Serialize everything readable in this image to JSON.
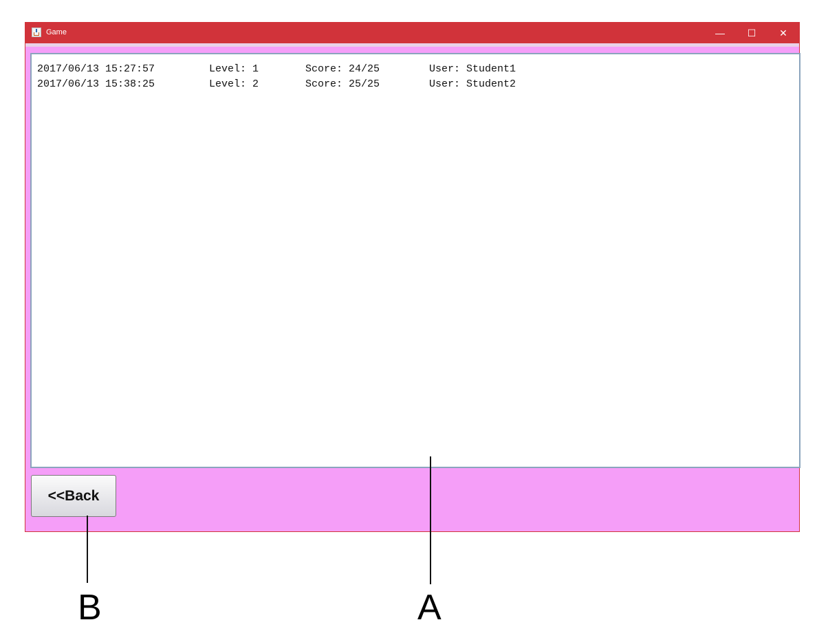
{
  "window": {
    "title": "Game",
    "controls": {
      "minimize": "—",
      "maximize": "☐",
      "close": "✕"
    },
    "accent_color": "#d1333a",
    "background_color": "#f59ef8"
  },
  "log": {
    "rows": [
      {
        "date": "2017/06/13 15:27:57",
        "level": "Level: 1",
        "score": "Score: 24/25",
        "user": "User: Student1"
      },
      {
        "date": "2017/06/13 15:38:25",
        "level": "Level: 2",
        "score": "Score: 25/25",
        "user": "User: Student2"
      }
    ]
  },
  "buttons": {
    "back_label": "<<Back"
  },
  "callouts": {
    "a": "A",
    "b": "B"
  }
}
